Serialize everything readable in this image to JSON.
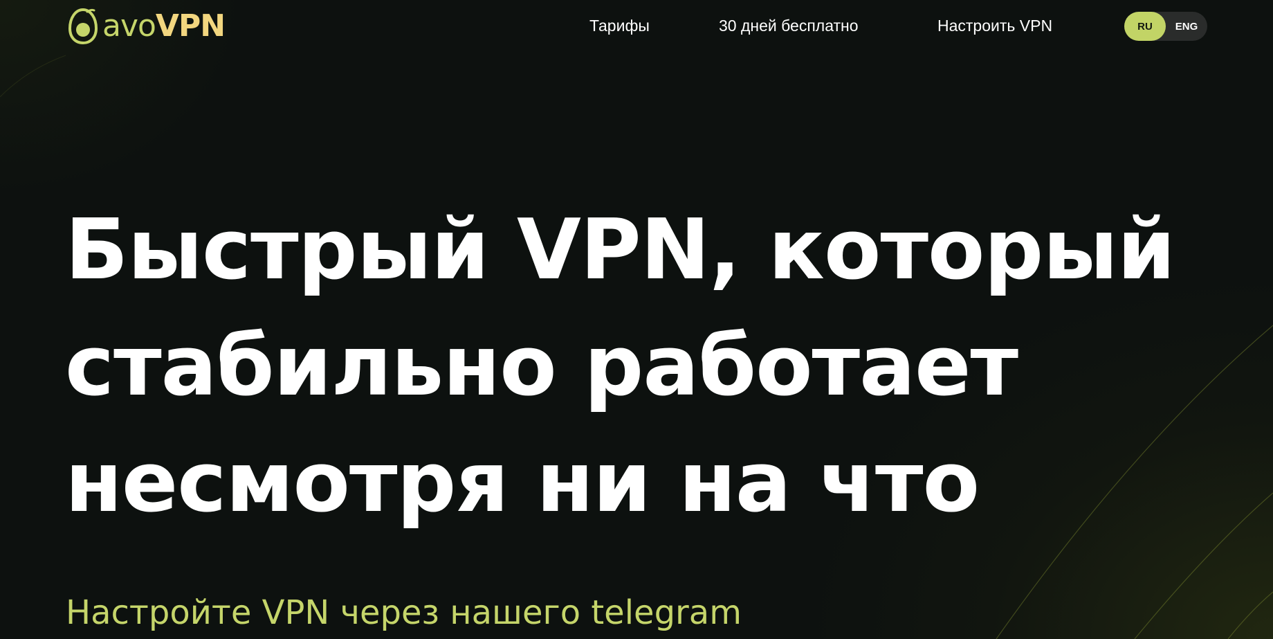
{
  "brand": {
    "logo_prefix": "avo",
    "logo_suffix": "VPN",
    "logo_icon": "avocado-icon",
    "colors": {
      "accent": "#c2d466",
      "logo_avo": "#c5d56a",
      "logo_vpn": "#f2d67f",
      "background": "#0d110f"
    }
  },
  "nav": {
    "items": [
      {
        "label": "Тарифы"
      },
      {
        "label": "30 дней бесплатно"
      },
      {
        "label": "Настроить VPN"
      }
    ]
  },
  "language_switch": {
    "options": [
      {
        "label": "RU",
        "active": true
      },
      {
        "label": "ENG",
        "active": false
      }
    ]
  },
  "hero": {
    "title_lines": [
      "Быстрый VPN, который",
      "стабильно работает",
      "несмотря ни на что"
    ],
    "subtitle": "Настройте VPN через нашего telegram"
  }
}
